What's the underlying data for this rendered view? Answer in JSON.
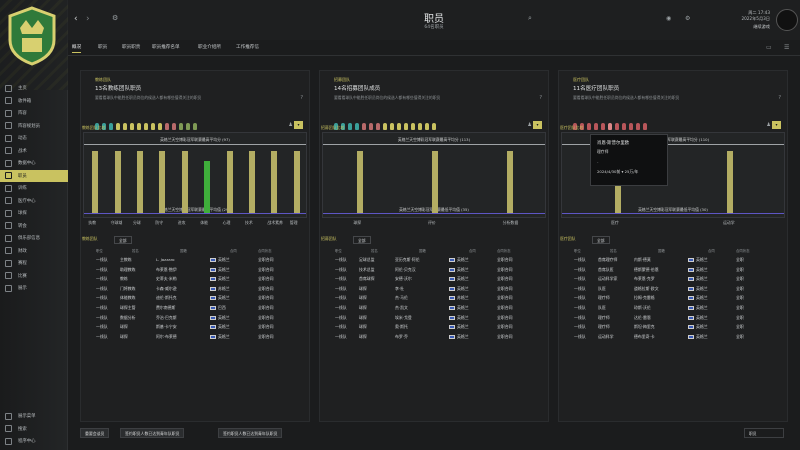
{
  "colors": {
    "accent": "#c9c260",
    "bar": "#b3ad63",
    "bar_highlight": "#3fae3b",
    "avg_line": "#5e56c4"
  },
  "sidebar": {
    "items": [
      {
        "label": "主页",
        "icon": "home-icon"
      },
      {
        "label": "收件箱",
        "icon": "inbox-icon"
      },
      {
        "label": "阵容",
        "icon": "squad-icon"
      },
      {
        "label": "阵容规划员",
        "icon": "planner-icon"
      },
      {
        "label": "动态",
        "icon": "dynamics-icon"
      },
      {
        "label": "战术",
        "icon": "tactics-icon"
      },
      {
        "label": "数据中心",
        "icon": "data-icon"
      },
      {
        "label": "职员",
        "icon": "staff-icon"
      },
      {
        "label": "训练",
        "icon": "training-icon"
      },
      {
        "label": "医疗中心",
        "icon": "medical-icon"
      },
      {
        "label": "球探",
        "icon": "scouting-icon"
      },
      {
        "label": "转会",
        "icon": "transfer-icon"
      },
      {
        "label": "俱乐部信息",
        "icon": "club-icon"
      },
      {
        "label": "财政",
        "icon": "finance-icon"
      },
      {
        "label": "赛程",
        "icon": "schedule-icon"
      },
      {
        "label": "比赛",
        "icon": "match-icon"
      },
      {
        "label": "展示"
      }
    ],
    "active_index": 7,
    "bottom_items": [
      {
        "label": "展示菜单",
        "icon": "menu-icon"
      },
      {
        "label": "搜索",
        "icon": "search-icon"
      },
      {
        "label": "程序中心",
        "icon": "app-icon"
      }
    ]
  },
  "header": {
    "title": "职员",
    "subtitle": "64名职员",
    "date_line1": "周二 17:43",
    "date_line2": "2022年5月3日",
    "continue_label": "继续游戏"
  },
  "tabs": [
    {
      "label": "概况"
    },
    {
      "label": "职员"
    },
    {
      "label": "职员职责"
    },
    {
      "label": "职员推荐名单"
    },
    {
      "label": "职业介绍所"
    },
    {
      "label": "工作推荐信"
    }
  ],
  "panels": [
    {
      "category": "教练团队",
      "heading": "13名教练团队职员",
      "description": "要看看球队中能胜任职员岗位的候选人都有哪些值得关注的职员",
      "legend": [
        "1/1教练组",
        "1/3教练组",
        "1/2守门员教练组",
        "1/1体能教练组",
        "1/1数据分析职员"
      ],
      "chart_label": "教练团队比较",
      "chart_top": "英格兰天空博彩冠军联赛最高平均分 (97)",
      "chart_bottom": "英格兰天空博彩冠军联赛最低平均值 (29)",
      "categories": [
        "执教",
        "守球域",
        "分球",
        "防守",
        "进攻",
        "体能",
        "心理",
        "技术",
        "战术素养",
        "管理"
      ],
      "table_category": "教练团队",
      "filter": "全部",
      "columns": [
        "职位",
        "姓名",
        "国籍",
        "合同",
        "合同状态"
      ],
      "rows": [
        {
          "pos": "一线队",
          "role": "主教练",
          "name": "L. Jazzaro",
          "nat": "英格兰",
          "status": "全职合同"
        },
        {
          "pos": "一线队",
          "role": "助理教练",
          "name": "布莱恩·鲍伊",
          "nat": "英格兰",
          "status": "全职合同"
        },
        {
          "pos": "一线队",
          "role": "教练",
          "name": "史蒂夫·米勒",
          "nat": "英格兰",
          "status": "全职合同"
        },
        {
          "pos": "一线队",
          "role": "门将教练",
          "name": "卡森·威尔逊",
          "nat": "苏格兰",
          "status": "全职合同"
        },
        {
          "pos": "一线队",
          "role": "体能教练",
          "name": "迪伦·斯托克",
          "nat": "英格兰",
          "status": "全职合同"
        },
        {
          "pos": "一线队",
          "role": "球探主管",
          "name": "费尔南德斯",
          "nat": "巴西",
          "status": "全职合同"
        },
        {
          "pos": "一线队",
          "role": "数据分析",
          "name": "乔治·巴克斯",
          "nat": "英格兰",
          "status": "全职合同"
        },
        {
          "pos": "一线队",
          "role": "球探",
          "name": "斯基·卡宁安",
          "nat": "英格兰",
          "status": "全职合同"
        },
        {
          "pos": "一线队",
          "role": "球探",
          "name": "阿尔·布莱德",
          "nat": "英格兰",
          "status": "全职合同"
        }
      ]
    },
    {
      "category": "招募团队",
      "heading": "14名招募团队成员",
      "description": "要看看球队中能胜任职员岗位的候选人都有哪些值得关注的职员",
      "legend": [
        "1/1职员球探",
        "1/2技术总监",
        "1/1首席球探",
        "1/1招募分析",
        "1/1球探经理"
      ],
      "chart_label": "招募团队比较",
      "chart_top": "英格兰天空博彩冠军联赛最高平均分 (113)",
      "chart_bottom": "英格兰天空博彩冠军联赛最低平均值 (35)",
      "categories": [
        "球探",
        "评价",
        "分析数据"
      ],
      "table_category": "招募团队",
      "filter": "全部",
      "columns": [
        "职位",
        "姓名",
        "国籍",
        "合同",
        "合同状态"
      ],
      "rows": [
        {
          "pos": "一线队",
          "role": "足球总监",
          "name": "亚历克斯·阿伦",
          "nat": "英格兰",
          "status": "全职合同"
        },
        {
          "pos": "一线队",
          "role": "技术总监",
          "name": "阿伦·贝克汉",
          "nat": "英格兰",
          "status": "全职合同"
        },
        {
          "pos": "一线队",
          "role": "首席球探",
          "name": "安德·沃尔",
          "nat": "英格兰",
          "status": "全职合同"
        },
        {
          "pos": "一线队",
          "role": "球探",
          "name": "李·杜",
          "nat": "英格兰",
          "status": "全职合同"
        },
        {
          "pos": "一线队",
          "role": "球探",
          "name": "杰·马伦",
          "nat": "苏格兰",
          "status": "全职合同"
        },
        {
          "pos": "一线队",
          "role": "球探",
          "name": "杰·凯文",
          "nat": "英格兰",
          "status": "全职合同"
        },
        {
          "pos": "一线队",
          "role": "球探",
          "name": "埃米·戈登",
          "nat": "英格兰",
          "status": "全职合同"
        },
        {
          "pos": "一线队",
          "role": "球探",
          "name": "奥·斯托",
          "nat": "英格兰",
          "status": "全职合同"
        },
        {
          "pos": "一线队",
          "role": "球探",
          "name": "布罗·乔",
          "nat": "英格兰",
          "status": "全职合同"
        }
      ]
    },
    {
      "category": "医疗团队",
      "heading": "11名医疗团队职员",
      "description": "要看看球队中能胜任职员岗位的候选人都有哪些值得关注的职员",
      "legend": [
        "1/1运动科学",
        "1/1队医",
        "1/2理疗师"
      ],
      "chart_label": "医疗团队比较",
      "chart_top": "英格兰天空博彩冠军联赛最高平均分 (110)",
      "chart_bottom": "英格兰天空博彩冠军联赛最低平均值 (30)",
      "categories": [
        "医疗",
        "运动学"
      ],
      "table_category": "医疗团队",
      "filter": "全部",
      "columns": [
        "职位",
        "姓名",
        "国籍",
        "合同",
        "合同状态"
      ],
      "rows": [
        {
          "pos": "一线队",
          "role": "首席理疗师",
          "name": "内斯·德莫",
          "nat": "英格兰",
          "status": "全职"
        },
        {
          "pos": "一线队",
          "role": "首席队医",
          "name": "德斯蒙德·伯恩",
          "nat": "英格兰",
          "status": "全职"
        },
        {
          "pos": "一线队",
          "role": "运动科学家",
          "name": "布莱恩·克罗",
          "nat": "英格兰",
          "status": "全职"
        },
        {
          "pos": "一线队",
          "role": "队医",
          "name": "道格拉斯·欧文",
          "nat": "英格兰",
          "status": "全职"
        },
        {
          "pos": "一线队",
          "role": "理疗师",
          "name": "拉姆·克雷格",
          "nat": "英格兰",
          "status": "全职"
        },
        {
          "pos": "一线队",
          "role": "队医",
          "name": "琼斯·沃伦",
          "nat": "英格兰",
          "status": "全职"
        },
        {
          "pos": "一线队",
          "role": "理疗师",
          "name": "达伦·雷恩",
          "nat": "英格兰",
          "status": "全职"
        },
        {
          "pos": "一线队",
          "role": "理疗师",
          "name": "斯坦·梅里克",
          "nat": "英格兰",
          "status": "全职"
        },
        {
          "pos": "一线队",
          "role": "运动科学",
          "name": "德布里奇·卡",
          "nat": "英格兰",
          "status": "全职"
        }
      ]
    }
  ],
  "tooltip": {
    "name": "肖恩·斯普尔里欧",
    "role": "理疗师",
    "dash": "-",
    "contract": "2024/4/30前 ▾ 25万/年"
  },
  "chart_data": [
    {
      "type": "bar",
      "title": "英格兰天空博彩冠军联赛最高平均分 (97)",
      "categories": [
        "执教",
        "守球域",
        "分球",
        "防守",
        "进攻",
        "体能",
        "心理",
        "技术",
        "战术素养",
        "管理"
      ],
      "values": [
        97,
        97,
        97,
        97,
        97,
        82,
        97,
        97,
        97,
        97
      ],
      "ylim": [
        0,
        97
      ]
    },
    {
      "type": "bar",
      "title": "英格兰天空博彩冠军联赛最高平均分 (113)",
      "categories": [
        "球探",
        "评价",
        "分析数据"
      ],
      "values": [
        113,
        113,
        113
      ],
      "ylim": [
        0,
        113
      ]
    },
    {
      "type": "bar",
      "title": "英格兰天空博彩冠军联赛最高平均分 (110)",
      "categories": [
        "医疗",
        "运动学"
      ],
      "values": [
        110,
        110
      ],
      "ylim": [
        0,
        110
      ]
    }
  ],
  "footer": {
    "btn1": "重要会谈员",
    "btn2": "签约职员人数已达到青年队职员",
    "btn3": "签约职员人数已达到青年队职员",
    "right": "职员"
  }
}
